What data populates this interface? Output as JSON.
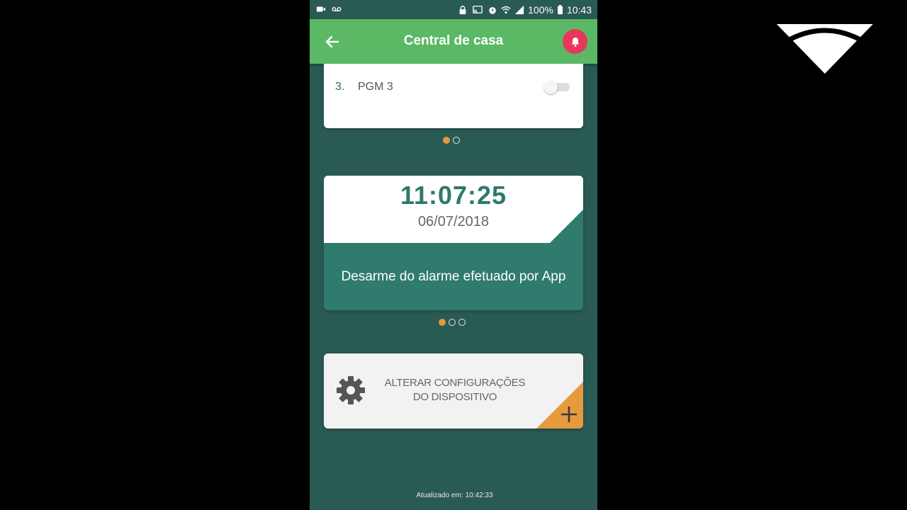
{
  "status_bar": {
    "battery": "100%",
    "time": "10:43",
    "icons": [
      "video-camera-icon",
      "voicemail-icon",
      "lock-icon",
      "cast-icon",
      "alarm-icon",
      "wifi-icon",
      "signal-icon",
      "battery-icon"
    ]
  },
  "app_bar": {
    "title": "Central de casa",
    "back_icon": "arrow-left-icon",
    "action_icon": "bell-icon",
    "action_color": "#e8375a",
    "color": "#5bb865"
  },
  "pgm_list": {
    "items": [
      {
        "number": "3.",
        "name": "PGM 3",
        "enabled": false
      }
    ],
    "pager": {
      "count": 2,
      "active_index": 0
    }
  },
  "event": {
    "time": "11:07:25",
    "date": "06/07/2018",
    "message": "Desarme do alarme efetuado por App",
    "color": "#2f7b6e",
    "pager": {
      "count": 3,
      "active_index": 0
    }
  },
  "config": {
    "label": "ALTERAR CONFIGURAÇÕES DO DISPOSITIVO",
    "icon": "gear-icon",
    "action_icon": "plus-icon",
    "accent": "#e59a3d"
  },
  "footer": {
    "updated_label": "Atualizado em:",
    "updated_time": "10:42:33"
  },
  "watermark": {
    "icon": "brand-logo-icon"
  }
}
